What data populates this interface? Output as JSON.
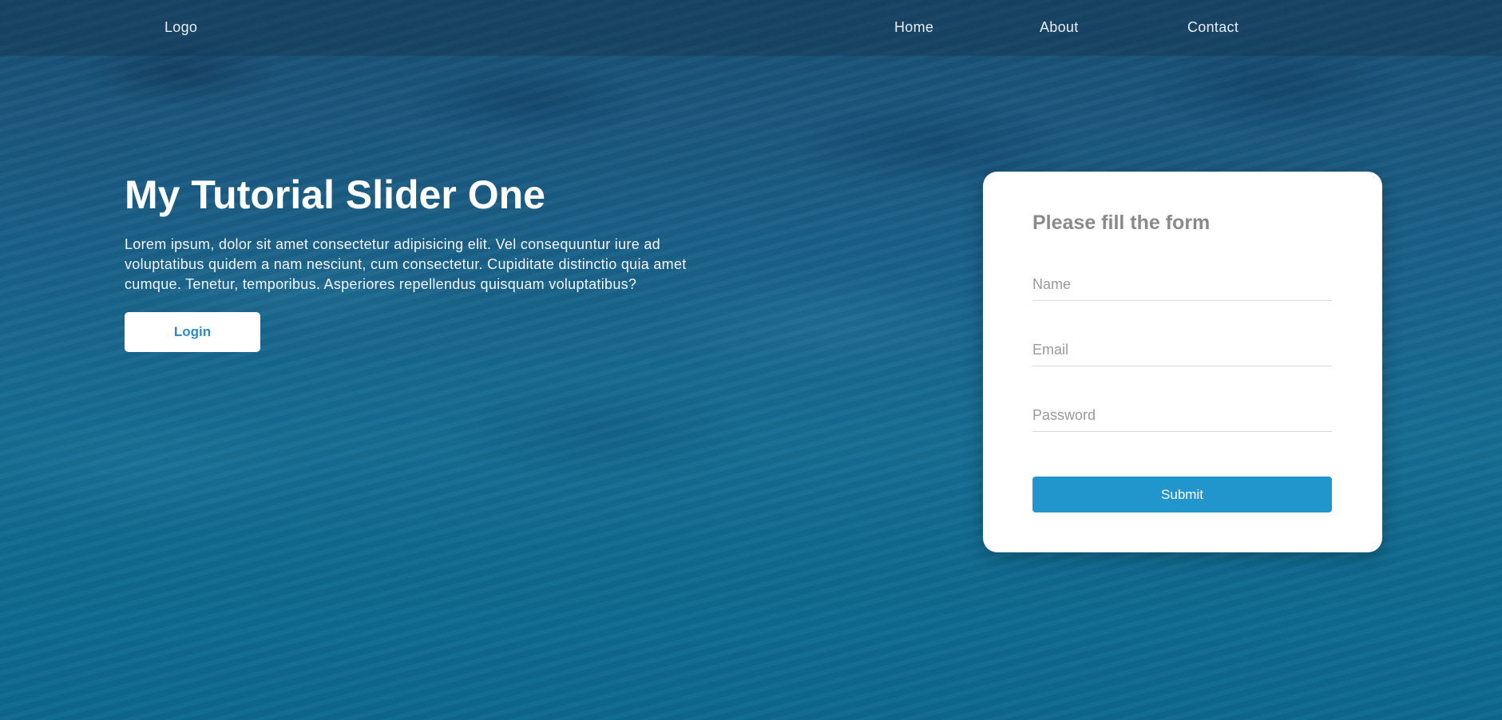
{
  "nav": {
    "logo": "Logo",
    "links": [
      {
        "label": "Home"
      },
      {
        "label": "About"
      },
      {
        "label": "Contact"
      }
    ]
  },
  "hero": {
    "title": "My Tutorial Slider One",
    "text": "Lorem ipsum, dolor sit amet consectetur adipisicing elit. Vel consequuntur iure ad voluptatibus quidem a nam nesciunt, cum consectetur. Cupiditate distinctio quia amet cumque. Tenetur, temporibus. Asperiores repellendus quisquam voluptatibus?",
    "login_label": "Login"
  },
  "form": {
    "title": "Please fill the form",
    "name_placeholder": "Name",
    "email_placeholder": "Email",
    "password_placeholder": "Password",
    "name_value": "",
    "email_value": "",
    "password_value": "",
    "submit_label": "Submit"
  },
  "colors": {
    "accent": "#2196cc",
    "login_text": "#2a8cc4",
    "background": "#0f5a7e"
  }
}
